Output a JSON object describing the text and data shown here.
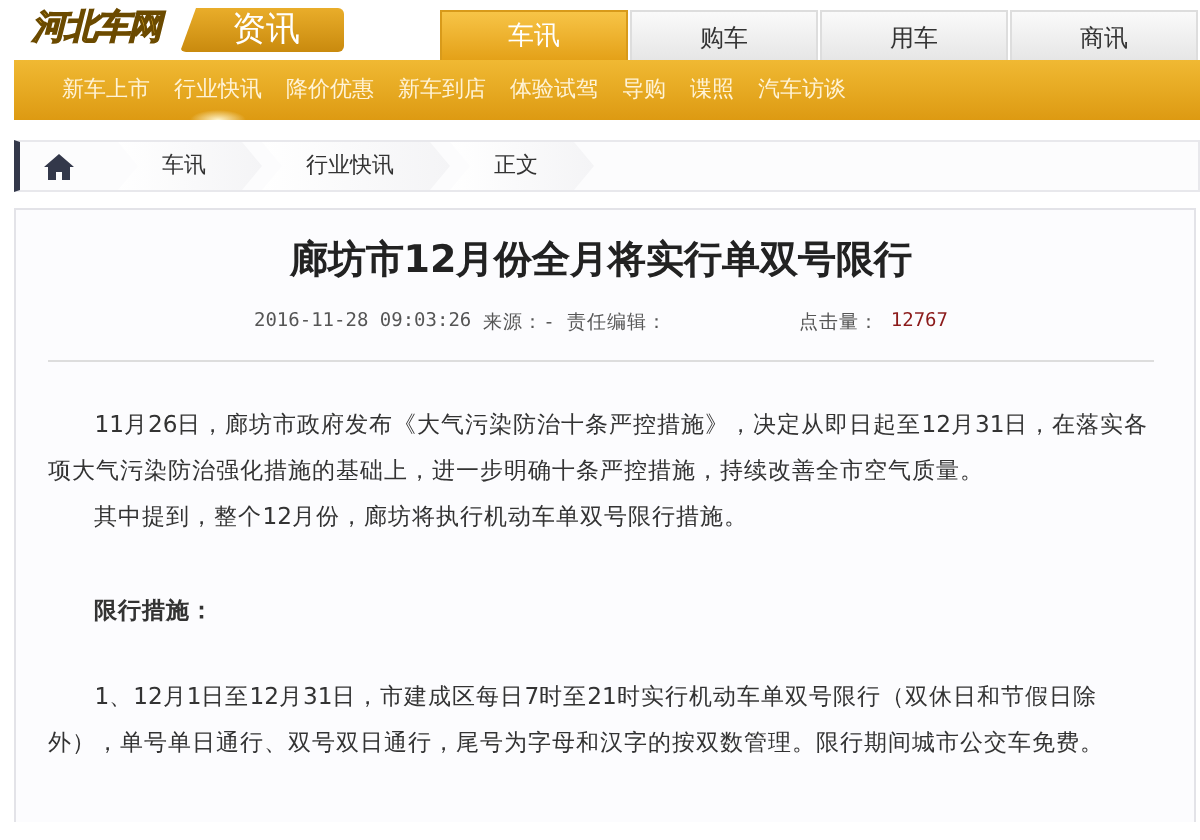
{
  "header": {
    "logo": "河北车网",
    "section": "资讯",
    "tabs": [
      {
        "label": "车讯",
        "selected": true
      },
      {
        "label": "购车",
        "selected": false
      },
      {
        "label": "用车",
        "selected": false
      },
      {
        "label": "商讯",
        "selected": false
      }
    ]
  },
  "subnav": [
    {
      "label": "新车上市",
      "selected": false
    },
    {
      "label": "行业快讯",
      "selected": true
    },
    {
      "label": "降价优惠",
      "selected": false
    },
    {
      "label": "新车到店",
      "selected": false
    },
    {
      "label": "体验试驾",
      "selected": false
    },
    {
      "label": "导购",
      "selected": false
    },
    {
      "label": "谍照",
      "selected": false
    },
    {
      "label": "汽车访谈",
      "selected": false
    }
  ],
  "breadcrumb": [
    "车讯",
    "行业快讯",
    "正文"
  ],
  "article": {
    "title": "廊坊市12月份全月将实行单双号限行",
    "meta": {
      "date": "2016-11-28 09:03:26",
      "source": "来源：-",
      "editor": "责任编辑：",
      "views_label": "点击量：",
      "views": "12767"
    },
    "paragraphs": [
      {
        "kind": "text",
        "text": "11月26日，廊坊市政府发布《大气污染防治十条严控措施》，决定从即日起至12月31日，在落实各项大气污染防治强化措施的基础上，进一步明确十条严控措施，持续改善全市空气质量。"
      },
      {
        "kind": "text",
        "text": "其中提到，整个12月份，廊坊将执行机动车单双号限行措施。"
      },
      {
        "kind": "heading",
        "text": "限行措施："
      },
      {
        "kind": "text",
        "text": "1、12月1日至12月31日，市建成区每日7时至21时实行机动车单双号限行（双休日和节假日除外），单号单日通行、双号双日通行，尾号为字母和汉字的按双数管理。限行期间城市公交车免费。"
      }
    ]
  }
}
